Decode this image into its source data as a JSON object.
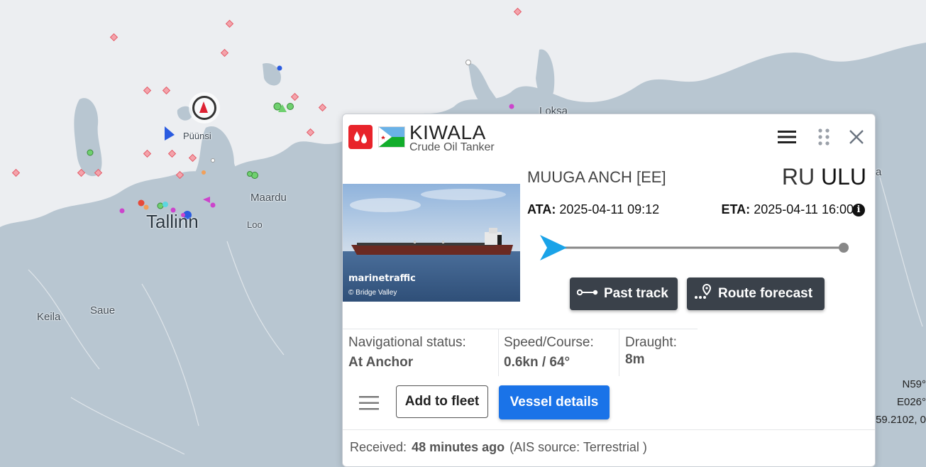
{
  "map": {
    "labels": {
      "puunsi": "Püünsi",
      "loksa": "Loksa",
      "maardu": "Maardu",
      "tallinn": "Tallinn",
      "loo": "Loo",
      "keila": "Keila",
      "saue": "Saue",
      "edge_a": "a"
    },
    "coords": {
      "lat": "N59°",
      "lon": "E026°",
      "decimal": "59.2102, 0"
    }
  },
  "popup": {
    "vessel_name": "KIWALA",
    "vessel_type": "Crude Oil Tanker",
    "type_icon": "tanker-drops-icon",
    "flag_icon": "djibouti-flag",
    "photo": {
      "watermark": "marinetraffic",
      "credit": "© Bridge Valley"
    },
    "departure_port": "MUUGA ANCH [EE]",
    "destination_country": "RU",
    "destination_port": "ULU",
    "ata_label": "ATA:",
    "ata_value": "2025-04-11 09:12",
    "eta_label": "ETA:",
    "eta_value": "2025-04-11 16:00",
    "buttons": {
      "past_track": "Past track",
      "route_forecast": "Route forecast",
      "add_to_fleet": "Add to fleet",
      "vessel_details": "Vessel details"
    },
    "stats": {
      "nav_status_label": "Navigational status:",
      "nav_status_value": "At Anchor",
      "speed_label": "Speed/Course:",
      "speed_value": "0.6kn / 64°",
      "draught_label": "Draught:",
      "draught_value": "8m"
    },
    "footer": {
      "received_label": "Received:",
      "received_value": "48 minutes ago",
      "source": "(AIS source: Terrestrial )"
    },
    "colors": {
      "accent": "#1a73e8",
      "dark_button": "#3a414a",
      "badge_red": "#e8232a",
      "progress_arrow": "#1aa3e8"
    }
  }
}
